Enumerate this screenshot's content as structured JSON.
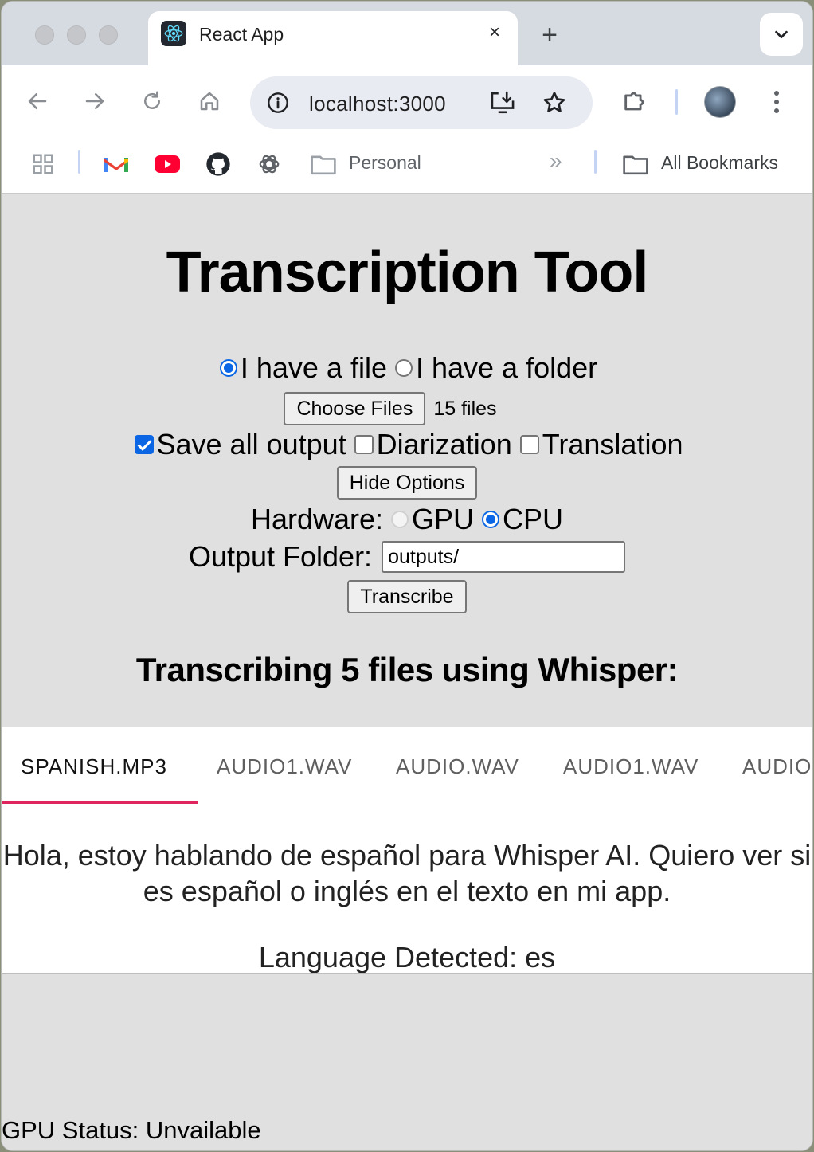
{
  "browser": {
    "tab_title": "React App",
    "tab_close": "×",
    "new_tab": "+",
    "url": "localhost:3000",
    "bookmarks": {
      "personal": "Personal",
      "overflow": "»",
      "all_bookmarks": "All Bookmarks"
    }
  },
  "app": {
    "title": "Transcription Tool",
    "mode": {
      "file_label": "I have a file",
      "folder_label": "I have a folder",
      "selected": "file"
    },
    "file_picker": {
      "button_label": "Choose Files",
      "status": "15 files"
    },
    "options": {
      "save_all_output": {
        "label": "Save all output",
        "checked": true
      },
      "diarization": {
        "label": "Diarization",
        "checked": false
      },
      "translation": {
        "label": "Translation",
        "checked": false
      }
    },
    "hide_options_label": "Hide Options",
    "hardware": {
      "label": "Hardware:",
      "gpu_label": "GPU",
      "cpu_label": "CPU",
      "selected": "CPU",
      "gpu_disabled": true
    },
    "output_folder": {
      "label": "Output Folder:",
      "value": "outputs/"
    },
    "transcribe_label": "Transcribe",
    "status_heading": "Transcribing 5 files using Whisper:",
    "result_tabs": [
      "SPANISH.MP3",
      "AUDIO1.WAV",
      "AUDIO.WAV",
      "AUDIO1.WAV",
      "AUDIO"
    ],
    "active_tab": 0,
    "transcript": "Hola, estoy hablando de español para Whisper AI. Quiero ver si es español o inglés en el texto en mi app.",
    "language_detected": "Language Detected: es",
    "gpu_status": "GPU Status: Unvailable"
  },
  "colors": {
    "accent": "#0a66e4",
    "tab_indicator": "#e0245e",
    "page_bg": "#e0e0e0"
  }
}
